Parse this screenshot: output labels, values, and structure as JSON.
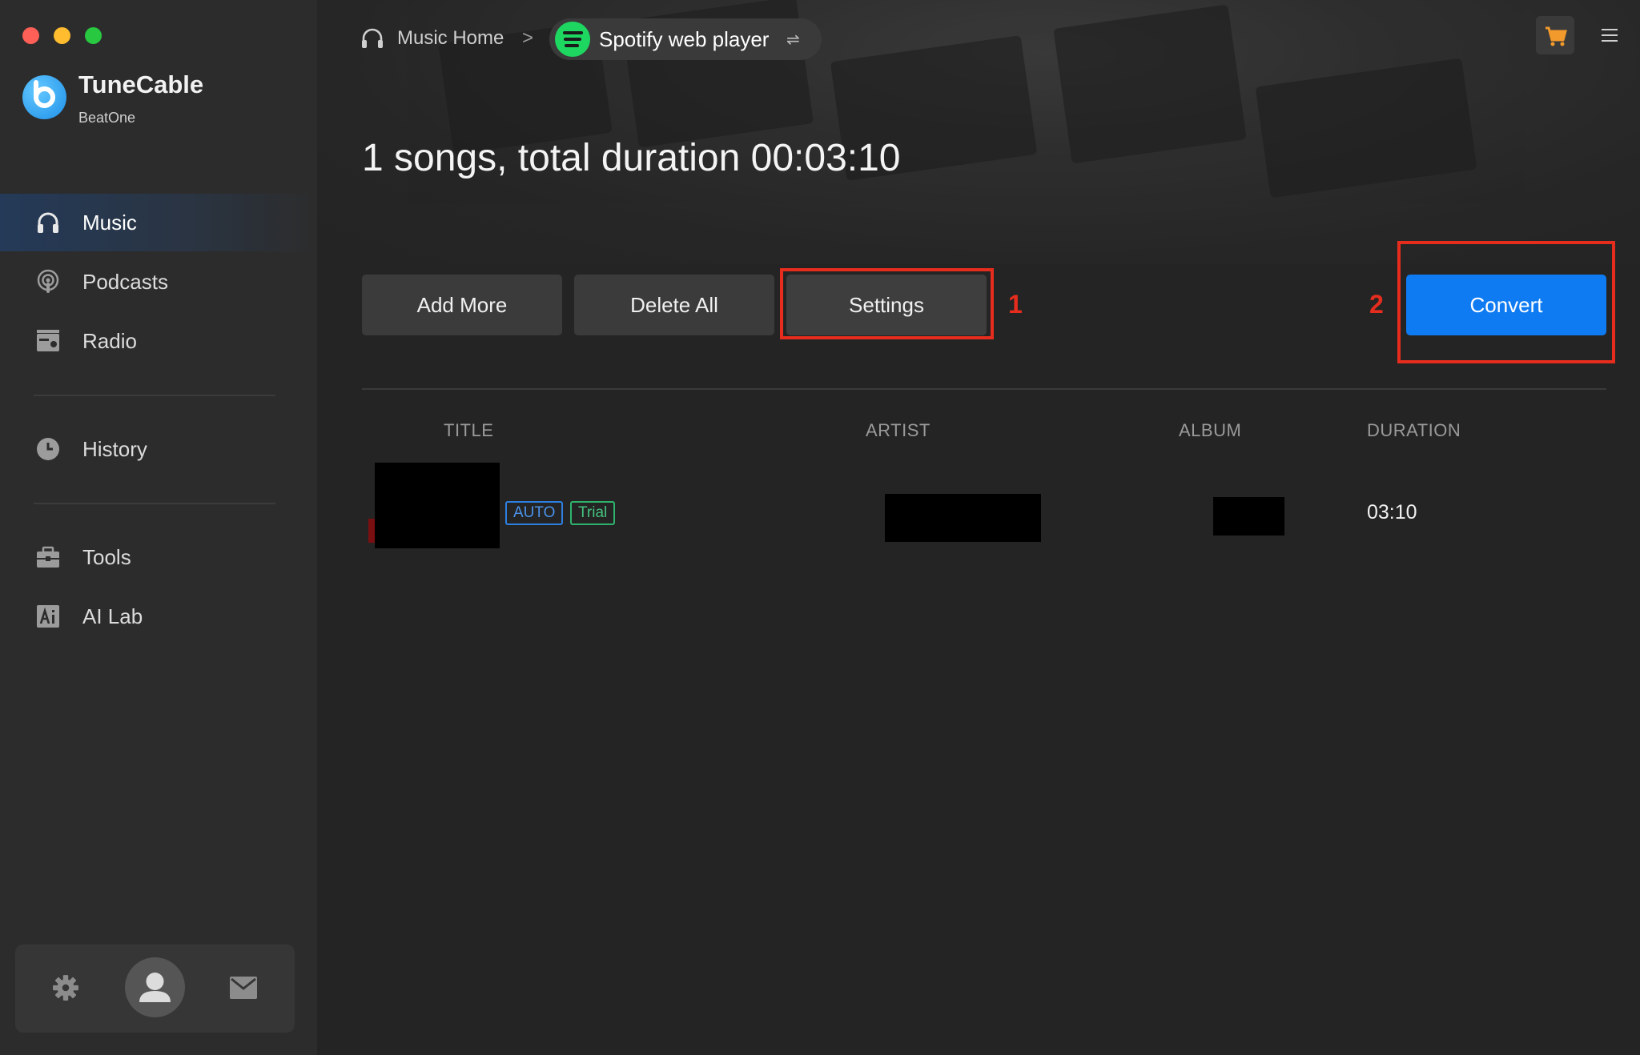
{
  "app": {
    "name": "TuneCable",
    "subtitle": "BeatOne"
  },
  "sidebar": {
    "items": [
      {
        "label": "Music",
        "icon": "headphones-icon",
        "active": true
      },
      {
        "label": "Podcasts",
        "icon": "podcast-icon",
        "active": false
      },
      {
        "label": "Radio",
        "icon": "radio-icon",
        "active": false
      },
      {
        "label": "History",
        "icon": "clock-icon",
        "active": false
      },
      {
        "label": "Tools",
        "icon": "toolbox-icon",
        "active": false
      },
      {
        "label": "AI Lab",
        "icon": "ai-icon",
        "active": false
      }
    ],
    "bottom_icons": [
      "gear-icon",
      "avatar-icon",
      "mail-icon"
    ]
  },
  "header": {
    "breadcrumb_home": "Music Home",
    "breadcrumb_separator": ">",
    "source": "Spotify web player",
    "swap_symbol": "⇌"
  },
  "main": {
    "summary": "1 songs, total duration 00:03:10",
    "buttons": {
      "add_more": "Add More",
      "delete_all": "Delete All",
      "settings": "Settings",
      "convert": "Convert"
    },
    "annotations": [
      "1",
      "2"
    ],
    "table": {
      "columns": [
        "TITLE",
        "ARTIST",
        "ALBUM",
        "DURATION"
      ],
      "rows": [
        {
          "tags": [
            "AUTO",
            "Trial"
          ],
          "duration": "03:10"
        }
      ]
    }
  },
  "colors": {
    "accent": "#0e7bf2",
    "highlight": "#e62d1d",
    "spotify": "#1ed760",
    "auto_tag": "#2e7fe0",
    "trial_tag": "#2fb36c"
  }
}
